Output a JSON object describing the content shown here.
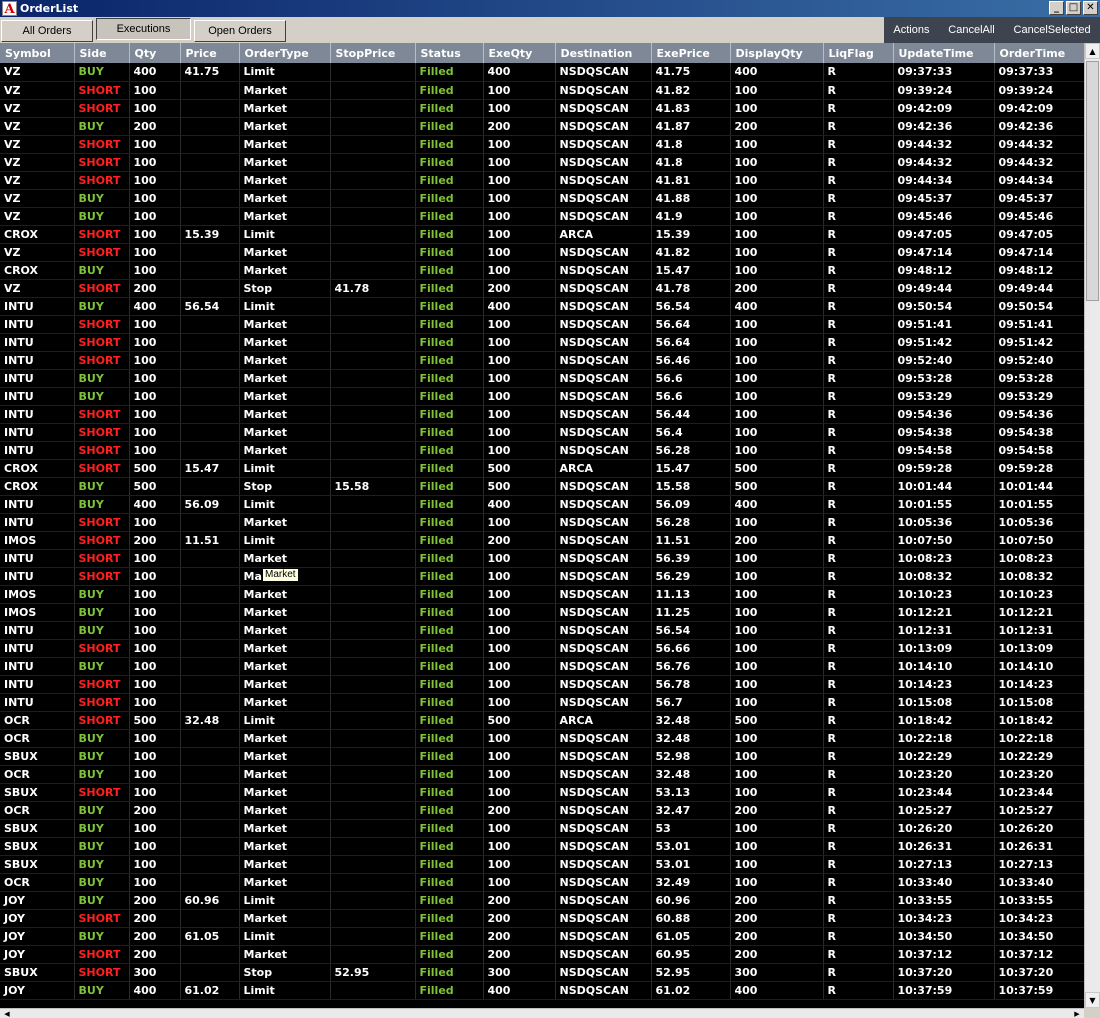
{
  "window": {
    "title": "OrderList",
    "app_icon_letter": "A"
  },
  "tabs": [
    {
      "label": "All Orders"
    },
    {
      "label": "Executions"
    },
    {
      "label": "Open Orders"
    }
  ],
  "actions": {
    "actions_label": "Actions",
    "cancel_all_label": "CancelAll",
    "cancel_selected_label": "CancelSelected"
  },
  "tooltip": {
    "text": "Market"
  },
  "colors": {
    "buy": "#7fc23a",
    "short": "#ff2020",
    "filled": "#7fc23a",
    "header_bg": "#7f8896",
    "actions_bg": "#3d4450"
  },
  "columns": [
    "Symbol",
    "Side",
    "Qty",
    "Price",
    "OrderType",
    "StopPrice",
    "Status",
    "ExeQty",
    "Destination",
    "ExePrice",
    "DisplayQty",
    "LiqFlag",
    "UpdateTime",
    "OrderTime"
  ],
  "rows": [
    [
      "VZ",
      "BUY",
      "400",
      "41.75",
      "Limit",
      "",
      "Filled",
      "400",
      "NSDQSCAN",
      "41.75",
      "400",
      "R",
      "09:37:33",
      "09:37:33"
    ],
    [
      "VZ",
      "SHORT",
      "100",
      "",
      "Market",
      "",
      "Filled",
      "100",
      "NSDQSCAN",
      "41.82",
      "100",
      "R",
      "09:39:24",
      "09:39:24"
    ],
    [
      "VZ",
      "SHORT",
      "100",
      "",
      "Market",
      "",
      "Filled",
      "100",
      "NSDQSCAN",
      "41.83",
      "100",
      "R",
      "09:42:09",
      "09:42:09"
    ],
    [
      "VZ",
      "BUY",
      "200",
      "",
      "Market",
      "",
      "Filled",
      "200",
      "NSDQSCAN",
      "41.87",
      "200",
      "R",
      "09:42:36",
      "09:42:36"
    ],
    [
      "VZ",
      "SHORT",
      "100",
      "",
      "Market",
      "",
      "Filled",
      "100",
      "NSDQSCAN",
      "41.8",
      "100",
      "R",
      "09:44:32",
      "09:44:32"
    ],
    [
      "VZ",
      "SHORT",
      "100",
      "",
      "Market",
      "",
      "Filled",
      "100",
      "NSDQSCAN",
      "41.8",
      "100",
      "R",
      "09:44:32",
      "09:44:32"
    ],
    [
      "VZ",
      "SHORT",
      "100",
      "",
      "Market",
      "",
      "Filled",
      "100",
      "NSDQSCAN",
      "41.81",
      "100",
      "R",
      "09:44:34",
      "09:44:34"
    ],
    [
      "VZ",
      "BUY",
      "100",
      "",
      "Market",
      "",
      "Filled",
      "100",
      "NSDQSCAN",
      "41.88",
      "100",
      "R",
      "09:45:37",
      "09:45:37"
    ],
    [
      "VZ",
      "BUY",
      "100",
      "",
      "Market",
      "",
      "Filled",
      "100",
      "NSDQSCAN",
      "41.9",
      "100",
      "R",
      "09:45:46",
      "09:45:46"
    ],
    [
      "CROX",
      "SHORT",
      "100",
      "15.39",
      "Limit",
      "",
      "Filled",
      "100",
      "ARCA",
      "15.39",
      "100",
      "R",
      "09:47:05",
      "09:47:05"
    ],
    [
      "VZ",
      "SHORT",
      "100",
      "",
      "Market",
      "",
      "Filled",
      "100",
      "NSDQSCAN",
      "41.82",
      "100",
      "R",
      "09:47:14",
      "09:47:14"
    ],
    [
      "CROX",
      "BUY",
      "100",
      "",
      "Market",
      "",
      "Filled",
      "100",
      "NSDQSCAN",
      "15.47",
      "100",
      "R",
      "09:48:12",
      "09:48:12"
    ],
    [
      "VZ",
      "SHORT",
      "200",
      "",
      "Stop",
      "41.78",
      "Filled",
      "200",
      "NSDQSCAN",
      "41.78",
      "200",
      "R",
      "09:49:44",
      "09:49:44"
    ],
    [
      "INTU",
      "BUY",
      "400",
      "56.54",
      "Limit",
      "",
      "Filled",
      "400",
      "NSDQSCAN",
      "56.54",
      "400",
      "R",
      "09:50:54",
      "09:50:54"
    ],
    [
      "INTU",
      "SHORT",
      "100",
      "",
      "Market",
      "",
      "Filled",
      "100",
      "NSDQSCAN",
      "56.64",
      "100",
      "R",
      "09:51:41",
      "09:51:41"
    ],
    [
      "INTU",
      "SHORT",
      "100",
      "",
      "Market",
      "",
      "Filled",
      "100",
      "NSDQSCAN",
      "56.64",
      "100",
      "R",
      "09:51:42",
      "09:51:42"
    ],
    [
      "INTU",
      "SHORT",
      "100",
      "",
      "Market",
      "",
      "Filled",
      "100",
      "NSDQSCAN",
      "56.46",
      "100",
      "R",
      "09:52:40",
      "09:52:40"
    ],
    [
      "INTU",
      "BUY",
      "100",
      "",
      "Market",
      "",
      "Filled",
      "100",
      "NSDQSCAN",
      "56.6",
      "100",
      "R",
      "09:53:28",
      "09:53:28"
    ],
    [
      "INTU",
      "BUY",
      "100",
      "",
      "Market",
      "",
      "Filled",
      "100",
      "NSDQSCAN",
      "56.6",
      "100",
      "R",
      "09:53:29",
      "09:53:29"
    ],
    [
      "INTU",
      "SHORT",
      "100",
      "",
      "Market",
      "",
      "Filled",
      "100",
      "NSDQSCAN",
      "56.44",
      "100",
      "R",
      "09:54:36",
      "09:54:36"
    ],
    [
      "INTU",
      "SHORT",
      "100",
      "",
      "Market",
      "",
      "Filled",
      "100",
      "NSDQSCAN",
      "56.4",
      "100",
      "R",
      "09:54:38",
      "09:54:38"
    ],
    [
      "INTU",
      "SHORT",
      "100",
      "",
      "Market",
      "",
      "Filled",
      "100",
      "NSDQSCAN",
      "56.28",
      "100",
      "R",
      "09:54:58",
      "09:54:58"
    ],
    [
      "CROX",
      "SHORT",
      "500",
      "15.47",
      "Limit",
      "",
      "Filled",
      "500",
      "ARCA",
      "15.47",
      "500",
      "R",
      "09:59:28",
      "09:59:28"
    ],
    [
      "CROX",
      "BUY",
      "500",
      "",
      "Stop",
      "15.58",
      "Filled",
      "500",
      "NSDQSCAN",
      "15.58",
      "500",
      "R",
      "10:01:44",
      "10:01:44"
    ],
    [
      "INTU",
      "BUY",
      "400",
      "56.09",
      "Limit",
      "",
      "Filled",
      "400",
      "NSDQSCAN",
      "56.09",
      "400",
      "R",
      "10:01:55",
      "10:01:55"
    ],
    [
      "INTU",
      "SHORT",
      "100",
      "",
      "Market",
      "",
      "Filled",
      "100",
      "NSDQSCAN",
      "56.28",
      "100",
      "R",
      "10:05:36",
      "10:05:36"
    ],
    [
      "IMOS",
      "SHORT",
      "200",
      "11.51",
      "Limit",
      "",
      "Filled",
      "200",
      "NSDQSCAN",
      "11.51",
      "200",
      "R",
      "10:07:50",
      "10:07:50"
    ],
    [
      "INTU",
      "SHORT",
      "100",
      "",
      "Market",
      "",
      "Filled",
      "100",
      "NSDQSCAN",
      "56.39",
      "100",
      "R",
      "10:08:23",
      "10:08:23"
    ],
    [
      "INTU",
      "SHORT",
      "100",
      "",
      "Market",
      "",
      "Filled",
      "100",
      "NSDQSCAN",
      "56.29",
      "100",
      "R",
      "10:08:32",
      "10:08:32"
    ],
    [
      "IMOS",
      "BUY",
      "100",
      "",
      "Market",
      "",
      "Filled",
      "100",
      "NSDQSCAN",
      "11.13",
      "100",
      "R",
      "10:10:23",
      "10:10:23"
    ],
    [
      "IMOS",
      "BUY",
      "100",
      "",
      "Market",
      "",
      "Filled",
      "100",
      "NSDQSCAN",
      "11.25",
      "100",
      "R",
      "10:12:21",
      "10:12:21"
    ],
    [
      "INTU",
      "BUY",
      "100",
      "",
      "Market",
      "",
      "Filled",
      "100",
      "NSDQSCAN",
      "56.54",
      "100",
      "R",
      "10:12:31",
      "10:12:31"
    ],
    [
      "INTU",
      "SHORT",
      "100",
      "",
      "Market",
      "",
      "Filled",
      "100",
      "NSDQSCAN",
      "56.66",
      "100",
      "R",
      "10:13:09",
      "10:13:09"
    ],
    [
      "INTU",
      "BUY",
      "100",
      "",
      "Market",
      "",
      "Filled",
      "100",
      "NSDQSCAN",
      "56.76",
      "100",
      "R",
      "10:14:10",
      "10:14:10"
    ],
    [
      "INTU",
      "SHORT",
      "100",
      "",
      "Market",
      "",
      "Filled",
      "100",
      "NSDQSCAN",
      "56.78",
      "100",
      "R",
      "10:14:23",
      "10:14:23"
    ],
    [
      "INTU",
      "SHORT",
      "100",
      "",
      "Market",
      "",
      "Filled",
      "100",
      "NSDQSCAN",
      "56.7",
      "100",
      "R",
      "10:15:08",
      "10:15:08"
    ],
    [
      "OCR",
      "SHORT",
      "500",
      "32.48",
      "Limit",
      "",
      "Filled",
      "500",
      "ARCA",
      "32.48",
      "500",
      "R",
      "10:18:42",
      "10:18:42"
    ],
    [
      "OCR",
      "BUY",
      "100",
      "",
      "Market",
      "",
      "Filled",
      "100",
      "NSDQSCAN",
      "32.48",
      "100",
      "R",
      "10:22:18",
      "10:22:18"
    ],
    [
      "SBUX",
      "BUY",
      "100",
      "",
      "Market",
      "",
      "Filled",
      "100",
      "NSDQSCAN",
      "52.98",
      "100",
      "R",
      "10:22:29",
      "10:22:29"
    ],
    [
      "OCR",
      "BUY",
      "100",
      "",
      "Market",
      "",
      "Filled",
      "100",
      "NSDQSCAN",
      "32.48",
      "100",
      "R",
      "10:23:20",
      "10:23:20"
    ],
    [
      "SBUX",
      "SHORT",
      "100",
      "",
      "Market",
      "",
      "Filled",
      "100",
      "NSDQSCAN",
      "53.13",
      "100",
      "R",
      "10:23:44",
      "10:23:44"
    ],
    [
      "OCR",
      "BUY",
      "200",
      "",
      "Market",
      "",
      "Filled",
      "200",
      "NSDQSCAN",
      "32.47",
      "200",
      "R",
      "10:25:27",
      "10:25:27"
    ],
    [
      "SBUX",
      "BUY",
      "100",
      "",
      "Market",
      "",
      "Filled",
      "100",
      "NSDQSCAN",
      "53",
      "100",
      "R",
      "10:26:20",
      "10:26:20"
    ],
    [
      "SBUX",
      "BUY",
      "100",
      "",
      "Market",
      "",
      "Filled",
      "100",
      "NSDQSCAN",
      "53.01",
      "100",
      "R",
      "10:26:31",
      "10:26:31"
    ],
    [
      "SBUX",
      "BUY",
      "100",
      "",
      "Market",
      "",
      "Filled",
      "100",
      "NSDQSCAN",
      "53.01",
      "100",
      "R",
      "10:27:13",
      "10:27:13"
    ],
    [
      "OCR",
      "BUY",
      "100",
      "",
      "Market",
      "",
      "Filled",
      "100",
      "NSDQSCAN",
      "32.49",
      "100",
      "R",
      "10:33:40",
      "10:33:40"
    ],
    [
      "JOY",
      "BUY",
      "200",
      "60.96",
      "Limit",
      "",
      "Filled",
      "200",
      "NSDQSCAN",
      "60.96",
      "200",
      "R",
      "10:33:55",
      "10:33:55"
    ],
    [
      "JOY",
      "SHORT",
      "200",
      "",
      "Market",
      "",
      "Filled",
      "200",
      "NSDQSCAN",
      "60.88",
      "200",
      "R",
      "10:34:23",
      "10:34:23"
    ],
    [
      "JOY",
      "BUY",
      "200",
      "61.05",
      "Limit",
      "",
      "Filled",
      "200",
      "NSDQSCAN",
      "61.05",
      "200",
      "R",
      "10:34:50",
      "10:34:50"
    ],
    [
      "JOY",
      "SHORT",
      "200",
      "",
      "Market",
      "",
      "Filled",
      "200",
      "NSDQSCAN",
      "60.95",
      "200",
      "R",
      "10:37:12",
      "10:37:12"
    ],
    [
      "SBUX",
      "SHORT",
      "300",
      "",
      "Stop",
      "52.95",
      "Filled",
      "300",
      "NSDQSCAN",
      "52.95",
      "300",
      "R",
      "10:37:20",
      "10:37:20"
    ],
    [
      "JOY",
      "BUY",
      "400",
      "61.02",
      "Limit",
      "",
      "Filled",
      "400",
      "NSDQSCAN",
      "61.02",
      "400",
      "R",
      "10:37:59",
      "10:37:59"
    ]
  ]
}
